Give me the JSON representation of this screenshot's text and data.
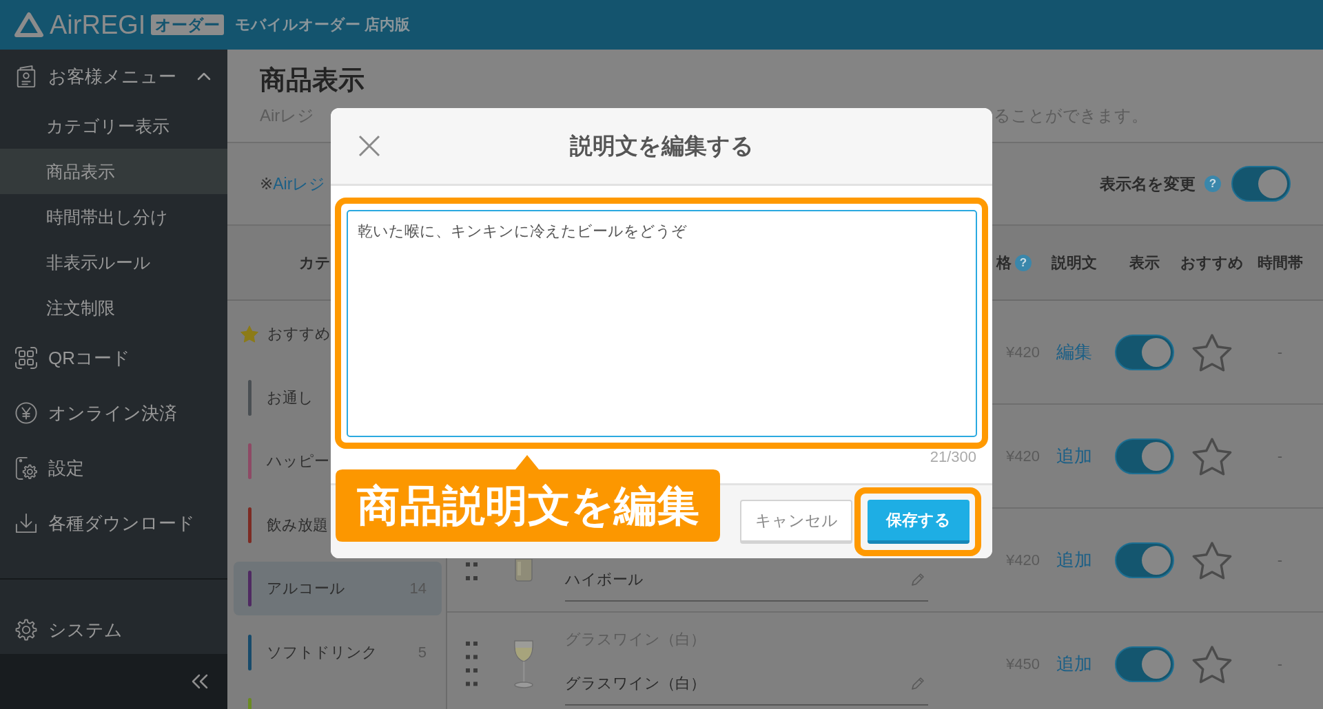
{
  "header": {
    "logo": "AirREGI",
    "badge": "オーダー",
    "product": "モバイルオーダー 店内版"
  },
  "sidebar": {
    "items": [
      {
        "kind": "menu",
        "label": "お客様メニュー",
        "selected": false,
        "expanded": true,
        "children": [
          {
            "label": "カテゴリー表示",
            "selected": false
          },
          {
            "label": "商品表示",
            "selected": true
          },
          {
            "label": "時間帯出し分け",
            "selected": false
          },
          {
            "label": "非表示ルール",
            "selected": false
          },
          {
            "label": "注文制限",
            "selected": false
          }
        ]
      },
      {
        "kind": "qr",
        "label": "QRコード",
        "selected": false
      },
      {
        "kind": "payment",
        "label": "オンライン決済",
        "selected": false
      },
      {
        "kind": "settings",
        "label": "設定",
        "selected": false
      },
      {
        "kind": "download",
        "label": "各種ダウンロード",
        "selected": false
      }
    ],
    "bottom_items": [
      {
        "kind": "system",
        "label": "システム",
        "selected": false
      }
    ]
  },
  "page": {
    "title": "商品表示",
    "description_start": "Airレジ",
    "description_end": "ることができます。"
  },
  "display_name": {
    "note_mark": "※",
    "note_link": "Airレジ",
    "label": "表示名を変更",
    "help": "?",
    "on": true
  },
  "table": {
    "category_header": "カテ",
    "columns": [
      {
        "kind": "price",
        "label": "格",
        "help": "?"
      },
      {
        "kind": "description",
        "label": "説明文"
      },
      {
        "kind": "visible",
        "label": "表示"
      },
      {
        "kind": "recommended",
        "label": "おすすめ"
      },
      {
        "kind": "time",
        "label": "時間帯"
      }
    ]
  },
  "categories": [
    {
      "kind": "featured",
      "name": "おすすめ",
      "selected": false
    },
    {
      "kind": "category",
      "name": "お通し",
      "color": "#4a4f53",
      "selected": false
    },
    {
      "kind": "category",
      "name": "ハッピー",
      "color": "#8e4a65",
      "selected": false
    },
    {
      "kind": "category",
      "name": "飲み放題",
      "color": "#7d2b23",
      "selected": false
    },
    {
      "kind": "category",
      "name": "アルコール",
      "count": "14",
      "color": "#4f2a62",
      "selected": true
    },
    {
      "kind": "category",
      "name": "ソフトドリンク",
      "count": "5",
      "color": "#174b6b",
      "selected": false
    },
    {
      "kind": "category",
      "color": "#6a8b22",
      "selected": false
    }
  ],
  "products": [
    {
      "kind": "right",
      "price": "¥420",
      "description_link": "編集",
      "visible": true,
      "recommended": false,
      "time_slot": "-"
    },
    {
      "kind": "right",
      "price": "¥420",
      "description_link": "追加",
      "visible": true,
      "recommended": false,
      "time_slot": "-"
    },
    {
      "kind": "lower",
      "name": "ハイボール",
      "price": "¥420",
      "description_link": "追加",
      "visible": true,
      "recommended": false,
      "time_slot": "-"
    },
    {
      "kind": "whole",
      "original_name": "グラスワイン（白）",
      "name": "グラスワイン（白）",
      "price": "¥450",
      "description_link": "追加",
      "visible": true,
      "recommended": false,
      "time_slot": "-"
    }
  ],
  "dialog": {
    "title": "説明文を編集する",
    "text": "乾いた喉に、キンキンに冷えたビールをどうぞ",
    "text_highlighted": true,
    "counter": "21/300",
    "buttons": [
      {
        "kind": "secondary",
        "label": "キャンセル"
      },
      {
        "kind": "primary",
        "label": "保存する",
        "highlighted": true
      }
    ]
  },
  "annotation": {
    "label": "商品説明文を編集"
  }
}
